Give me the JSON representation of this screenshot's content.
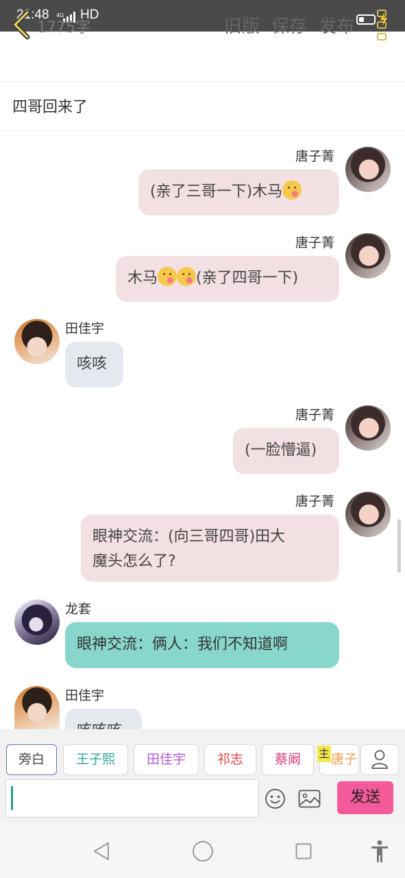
{
  "status_bar": {
    "time": "21:48",
    "network": "4G",
    "hd": "HD"
  },
  "header": {
    "word_count": "1775字",
    "actions": {
      "old_version": "旧版",
      "save": "保存",
      "publish": "发布"
    }
  },
  "story_title": "四哥回来了",
  "messages": [
    {
      "sender": "唐子菁",
      "side": "right",
      "text": "(亲了三哥一下)木马"
    },
    {
      "sender": "唐子菁",
      "side": "right",
      "text_before": "木马",
      "text_after": "(亲了四哥一下)"
    },
    {
      "sender": "田佳宇",
      "side": "left",
      "text": "咳咳"
    },
    {
      "sender": "唐子菁",
      "side": "right",
      "text": "(一脸懵逼)"
    },
    {
      "sender": "唐子菁",
      "side": "right",
      "line1": "眼神交流：(向三哥四哥)田大",
      "line2": "魔头怎么了?"
    },
    {
      "sender": "龙套",
      "side": "left",
      "text": "眼神交流：俩人：我们不知道啊"
    },
    {
      "sender": "田佳宇",
      "side": "left",
      "text": "咳咳咳"
    }
  ],
  "characters": {
    "narrator": "旁白",
    "items": [
      "王子熙",
      "田佳宇",
      "祁志",
      "蔡阚",
      "唐子"
    ],
    "main_tag": "主"
  },
  "composer": {
    "placeholder": "",
    "send_label": "发送"
  },
  "icons": {
    "back": "chevron-left-icon",
    "more": "more-vertical-icon",
    "emoji": "smiley-icon",
    "image": "image-icon",
    "user": "user-icon",
    "nav_back": "triangle-back-icon",
    "nav_home": "circle-home-icon",
    "nav_recent": "square-recent-icon",
    "accessibility": "accessibility-icon"
  },
  "colors": {
    "accent_pink": "#f25a9a",
    "bubble_pink": "#f2e0e2",
    "bubble_gray": "#e4e9f0",
    "bubble_teal": "#88d6cc",
    "icon_gold": "#d4b84a"
  }
}
